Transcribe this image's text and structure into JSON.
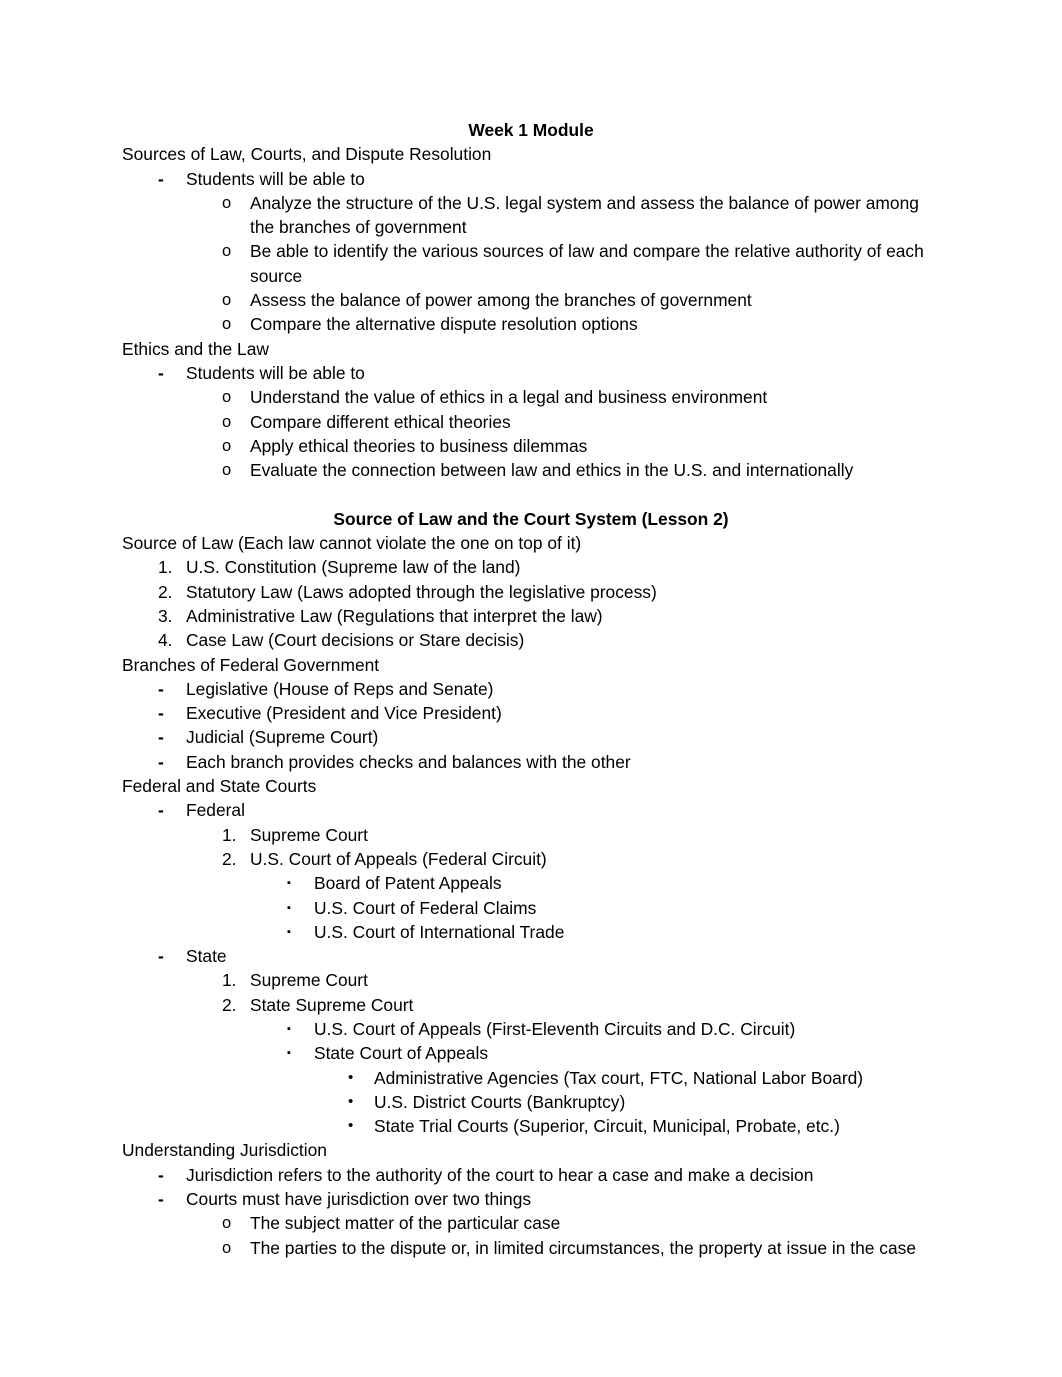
{
  "document": {
    "title": "Week 1 Module",
    "lesson2_heading": "Source of Law and the Court System (Lesson 2)",
    "sections": {
      "sources_of_law_heading": "Sources of Law, Courts, and Dispute Resolution",
      "students_will_be_able_to_1": "Students will be able to",
      "objective_1": "Analyze the structure of the U.S. legal system and assess the balance of power among the branches of government",
      "objective_2": "Be able to identify the various sources of law and compare the relative authority of each source",
      "objective_3": "Assess the balance of power among the branches of government",
      "objective_4": "Compare the alternative dispute resolution options",
      "ethics_heading": "Ethics and the Law",
      "students_will_be_able_to_2": "Students will be able to",
      "ethics_objective_1": "Understand the value of ethics in a legal and business environment",
      "ethics_objective_2": "Compare different ethical theories",
      "ethics_objective_3": "Apply ethical theories to business dilemmas",
      "ethics_objective_4": "Evaluate the connection between law and ethics in the U.S. and internationally",
      "source_of_law_heading": "Source of Law (Each law cannot violate the one on top of it)",
      "source_1": "U.S. Constitution (Supreme law of the land)",
      "source_2": "Statutory Law (Laws adopted through the legislative process)",
      "source_3": "Administrative Law (Regulations that interpret the law)",
      "source_4": "Case Law (Court decisions or Stare decisis)",
      "branches_heading": "Branches of Federal Government",
      "branch_1": "Legislative (House of Reps and Senate)",
      "branch_2": "Executive (President and Vice President)",
      "branch_3": "Judicial (Supreme Court)",
      "branch_4": "Each branch provides checks and balances with the other",
      "courts_heading": "Federal and State Courts",
      "federal_label": "Federal",
      "federal_1": "Supreme Court",
      "federal_2": "U.S. Court of Appeals (Federal Circuit)",
      "federal_2a": "Board of Patent Appeals",
      "federal_2b": "U.S. Court of Federal Claims",
      "federal_2c": "U.S. Court of International Trade",
      "state_label": "State",
      "state_1": "Supreme Court",
      "state_2": "State Supreme Court",
      "state_2a": "U.S. Court of Appeals (First-Eleventh Circuits and D.C. Circuit)",
      "state_2b": "State Court of Appeals",
      "state_2b_i": "Administrative Agencies (Tax court, FTC, National Labor Board)",
      "state_2b_ii": "U.S. District Courts (Bankruptcy)",
      "state_2b_iii": "State Trial Courts (Superior, Circuit, Municipal, Probate, etc.)",
      "jurisdiction_heading": "Understanding Jurisdiction",
      "jurisdiction_1": "Jurisdiction refers to the authority of the court to hear a case and make a decision",
      "jurisdiction_2": "Courts must have jurisdiction over two things",
      "jurisdiction_2a": "The subject matter of the particular case",
      "jurisdiction_2b": "The parties to the dispute or, in limited circumstances, the property at issue in the case"
    },
    "markers": {
      "dash": "-",
      "circle": "o",
      "square": "▪",
      "round": "•",
      "num_1": "1.",
      "num_2": "2.",
      "num_3": "3.",
      "num_4": "4."
    }
  }
}
